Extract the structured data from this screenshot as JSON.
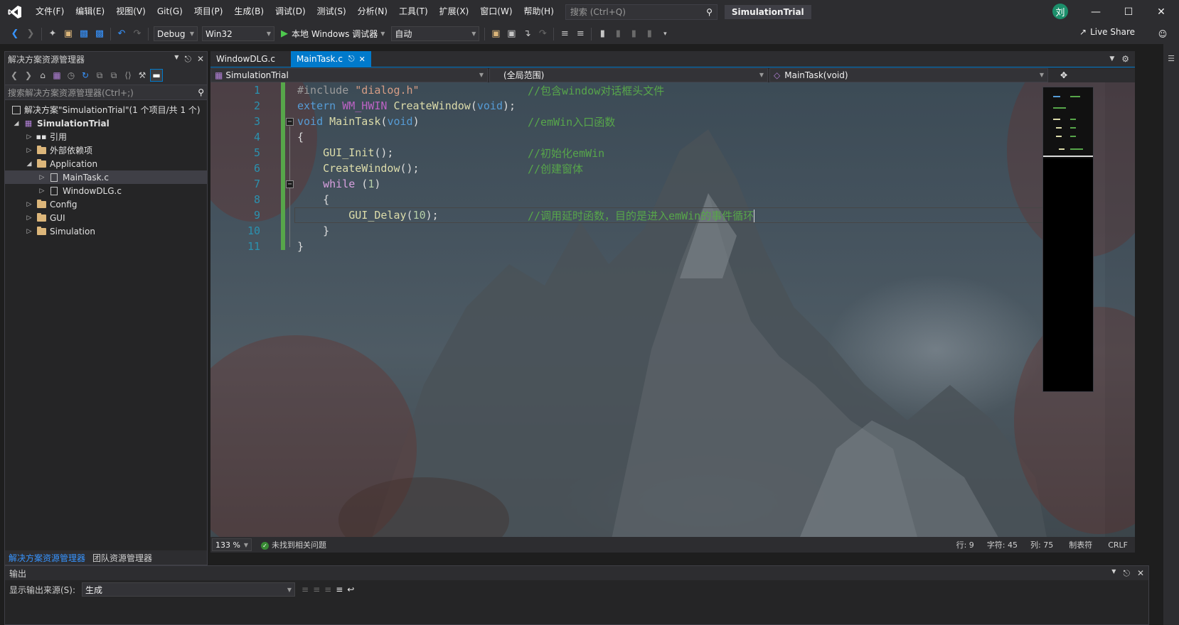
{
  "menubar": {
    "items": [
      "文件(F)",
      "编辑(E)",
      "视图(V)",
      "Git(G)",
      "项目(P)",
      "生成(B)",
      "调试(D)",
      "测试(S)",
      "分析(N)",
      "工具(T)",
      "扩展(X)",
      "窗口(W)",
      "帮助(H)"
    ],
    "search_placeholder": "搜索 (Ctrl+Q)",
    "solution_name": "SimulationTrial",
    "avatar_initial": "刘"
  },
  "toolbar": {
    "config": "Debug",
    "platform": "Win32",
    "run_label": "本地 Windows 调试器",
    "run_mode": "自动",
    "live_share": "Live Share"
  },
  "solution_explorer": {
    "title": "解决方案资源管理器",
    "search_placeholder": "搜索解决方案资源管理器(Ctrl+;)",
    "tree": [
      {
        "label": "解决方案\"SimulationTrial\"(1 个项目/共 1 个)"
      },
      {
        "label": "SimulationTrial"
      },
      {
        "label": "引用"
      },
      {
        "label": "外部依赖项"
      },
      {
        "label": "Application"
      },
      {
        "label": "MainTask.c"
      },
      {
        "label": "WindowDLG.c"
      },
      {
        "label": "Config"
      },
      {
        "label": "GUI"
      },
      {
        "label": "Simulation"
      }
    ],
    "tabs": [
      "解决方案资源管理器",
      "团队资源管理器"
    ]
  },
  "editor": {
    "tabs": [
      {
        "label": "WindowDLG.c"
      },
      {
        "label": "MainTask.c"
      }
    ],
    "nav": {
      "project": "SimulationTrial",
      "scope": "(全局范围)",
      "member": "MainTask(void)"
    },
    "line_numbers": [
      "1",
      "2",
      "3",
      "4",
      "5",
      "6",
      "7",
      "8",
      "9",
      "10",
      "11"
    ],
    "comments": {
      "c1": "//包含window对话框头文件",
      "c3": "//emWin入口函数",
      "c5": "//初始化emWin",
      "c6": "//创建窗体",
      "c9": "//调用延时函数，目的是进入emWin的事件循环"
    },
    "status": {
      "zoom": "133 %",
      "issues": "未找到相关问题",
      "line": "行: 9",
      "char": "字符: 45",
      "col": "列: 75",
      "tabs": "制表符",
      "eol": "CRLF"
    }
  },
  "output": {
    "title": "输出",
    "source_label": "显示输出来源(S):",
    "source_value": "生成"
  },
  "colors": {
    "accent": "#007acc",
    "keyword": "#569cd6",
    "comment": "#57a64a",
    "line_number": "#2b91af",
    "change_bar": "#57a64a"
  }
}
